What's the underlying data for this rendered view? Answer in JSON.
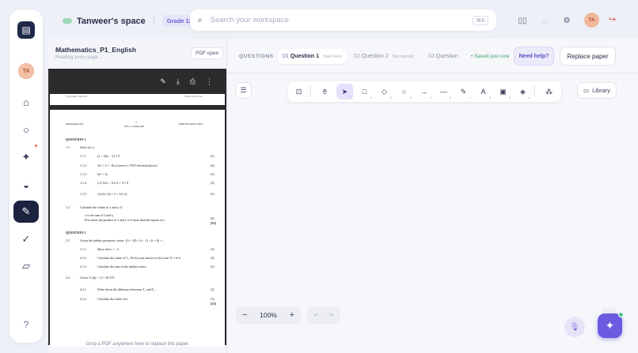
{
  "rail": {
    "logo_icon": "book-icon",
    "avatar_initials": "TA",
    "items": [
      {
        "name": "home-icon",
        "glyph": "⌂"
      },
      {
        "name": "circle-icon",
        "glyph": "○"
      },
      {
        "name": "sparkle-icon",
        "glyph": "✦"
      },
      {
        "name": "half-circle-icon",
        "glyph": "◒"
      },
      {
        "name": "pen-squiggle-icon",
        "glyph": "✎"
      },
      {
        "name": "check-icon",
        "glyph": "✓"
      },
      {
        "name": "eraser-icon",
        "glyph": "▱"
      }
    ],
    "help_glyph": "?"
  },
  "header": {
    "space_name": "Tanweer's space",
    "grade": "Grade 12",
    "search_placeholder": "Search your workspace",
    "search_shortcut": "⌘K",
    "avatar_initials": "TA"
  },
  "document": {
    "title": "Mathematics_P1_English",
    "subtitle": "Reading every page...",
    "pdf_open_label": "PDF open",
    "drop_hint": "Drop a PDF anywhere here to replace this paper",
    "prev_page_left": "Copyright reserved",
    "prev_page_right": "Please turn over",
    "page_header_left": "Mathematics/P1",
    "page_header_center": "3",
    "page_header_center2": "NSC Confidential",
    "page_header_right": "DBE/November 2021",
    "q1_title": "QUESTION 1",
    "q1_1": "Solve for x:",
    "q1_1_1": "(x + 5)(x − 2) = 0",
    "q1_1_2": "3x² + 2 = −8x   (correct to TWO decimal places)",
    "q1_1_3": "6x² > 2x",
    "q1_1_4": "2.2^(2x) − 0.2^x + 4 = 0",
    "q1_1_5": "√(x/(x+1)) + 2 = 3/(√x)",
    "q1_2": "Calculate the values of x and y if:",
    "q1_2_b1": "x is the sum of 2 and y",
    "q1_2_b2": "Five times the product of x and y is 6 more than the square of x",
    "q2_title": "QUESTION 2",
    "q2_1": "Given the infinite geometric series: 1(t + 10) + (t − 2) + (t + 6) + ...",
    "q2_1_1": "Show that r = −2",
    "q2_1_2": "Calculate the value of T₂. Write your answer in the form Tₙ = b^n",
    "q2_1_3": "Calculate the sum of the infinite series.",
    "q2_2": "Given: Σ (4p − 1) = 20 475",
    "q2_2_1": "Write down the difference between T₁ and T₂.",
    "q2_2_2": "Calculate the value of k.",
    "marks": [
      "(2)",
      "(4)",
      "(3)",
      "(4)",
      "(5)",
      "(6)",
      "[25]",
      "(3)",
      "(4)",
      "(2)",
      "(2)",
      "(5)",
      "[15]"
    ]
  },
  "questions": {
    "label": "QUESTIONS",
    "tabs": [
      {
        "num": "01",
        "title": "Question 1",
        "status": "Start here"
      },
      {
        "num": "02",
        "title": "Question 2",
        "status": "Not started"
      },
      {
        "num": "03",
        "title": "Question",
        "status": ""
      }
    ],
    "saved": "• Saved just now",
    "need_help": "Need help?",
    "replace_paper": "Replace paper"
  },
  "canvas": {
    "library_label": "Library",
    "zoom": "100%",
    "tools": [
      {
        "name": "lock-icon",
        "glyph": "🔓︎",
        "key": ""
      },
      {
        "name": "hand-icon",
        "glyph": "✋︎",
        "key": ""
      },
      {
        "name": "select-arrow-icon",
        "glyph": "➤",
        "key": "1"
      },
      {
        "name": "rectangle-icon",
        "glyph": "□",
        "key": "2"
      },
      {
        "name": "diamond-icon",
        "glyph": "◇",
        "key": "3"
      },
      {
        "name": "ellipse-icon",
        "glyph": "○",
        "key": "4"
      },
      {
        "name": "arrow-icon",
        "glyph": "→",
        "key": "5"
      },
      {
        "name": "line-icon",
        "glyph": "—",
        "key": "6"
      },
      {
        "name": "pencil-icon",
        "glyph": "✎",
        "key": "7"
      },
      {
        "name": "text-icon",
        "glyph": "A",
        "key": "8"
      },
      {
        "name": "image-icon",
        "glyph": "▣",
        "key": "9"
      },
      {
        "name": "eraser-tool-icon",
        "glyph": "◈",
        "key": "0"
      },
      {
        "name": "shapes-icon",
        "glyph": "⁂",
        "key": ""
      }
    ]
  },
  "colors": {
    "accent": "#6a5be0",
    "rail_active": "#1c2340",
    "saved": "#3aa36a"
  }
}
